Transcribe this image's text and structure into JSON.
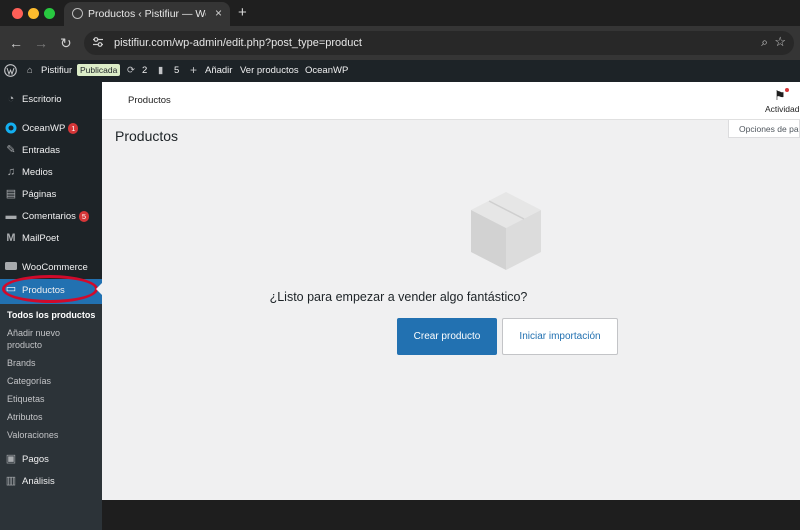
{
  "browser": {
    "tab_title": "Productos ‹ Pistifiur — WordPress",
    "tab_close": "×",
    "new_tab": "+",
    "url": "pistifiur.com/wp-admin/edit.php?post_type=product",
    "back_icon": "←",
    "forward_icon": "→",
    "reload_icon": "↻",
    "zoom_icon": "⌕",
    "bookmark_icon": "☆"
  },
  "adminbar": {
    "site_name": "Pistifiur",
    "status_badge": "Publicada",
    "updates_count": "2",
    "comments_count": "5",
    "add_new": "Añadir",
    "view_products": "Ver productos",
    "theme": "OceanWP"
  },
  "sidebar": {
    "items": [
      {
        "label": "Escritorio",
        "icon": "dashboard-icon"
      },
      {
        "label": "OceanWP",
        "icon": "oceanwp-icon",
        "count": "1"
      },
      {
        "label": "Entradas",
        "icon": "pin-icon"
      },
      {
        "label": "Medios",
        "icon": "media-icon"
      },
      {
        "label": "Páginas",
        "icon": "pages-icon"
      },
      {
        "label": "Comentarios",
        "icon": "comments-icon",
        "count": "5"
      },
      {
        "label": "MailPoet",
        "icon": "mailpoet-icon"
      },
      {
        "label": "WooCommerce",
        "icon": "woocommerce-icon"
      },
      {
        "label": "Productos",
        "icon": "products-icon"
      },
      {
        "label": "Pagos",
        "icon": "payments-icon"
      },
      {
        "label": "Análisis",
        "icon": "analytics-icon"
      }
    ],
    "submenu": [
      "Todos los productos",
      "Añadir nuevo",
      "producto",
      "Brands",
      "Categorías",
      "Etiquetas",
      "Atributos",
      "Valoraciones"
    ]
  },
  "page": {
    "breadcrumb": "Productos",
    "activity_label": "Actividad",
    "screen_options": "Opciones de pa",
    "title": "Productos",
    "empty_title": "¿Listo para empezar a vender algo fantástico?",
    "create_button": "Crear producto",
    "import_button": "Iniciar importación"
  },
  "colors": {
    "accent": "#2271b1",
    "sidebar_bg": "#1d2327",
    "highlight_circle": "#d10a2b"
  }
}
